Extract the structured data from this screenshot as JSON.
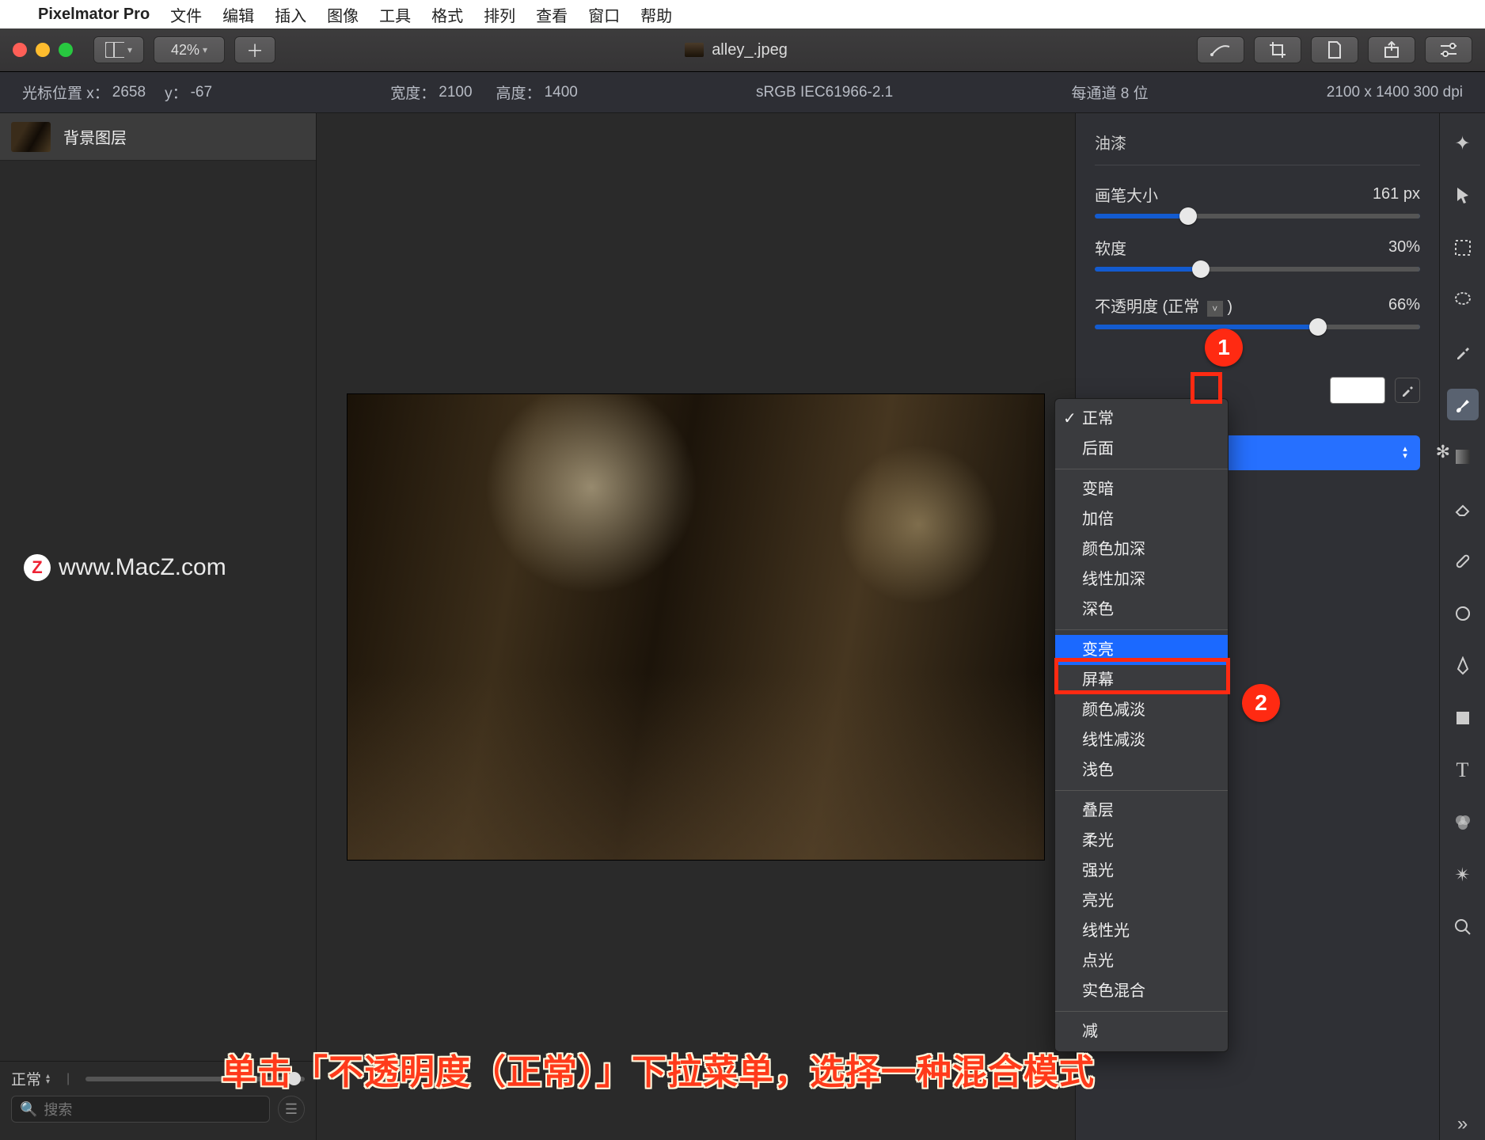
{
  "menubar": {
    "app": "Pixelmator Pro",
    "items": [
      "文件",
      "编辑",
      "插入",
      "图像",
      "工具",
      "格式",
      "排列",
      "查看",
      "窗口",
      "帮助"
    ]
  },
  "toolbar": {
    "zoom": "42%",
    "doc_title": "alley_.jpeg"
  },
  "infobar": {
    "cursor_label": "光标位置 x：",
    "cursor_x": "2658",
    "cursor_y_label": "y：",
    "cursor_y": "-67",
    "width_label": "宽度：",
    "width": "2100",
    "height_label": "高度：",
    "height": "1400",
    "colorspace": "sRGB IEC61966-2.1",
    "depth": "每通道 8 位",
    "dims": "2100 x 1400 300 dpi"
  },
  "layers": {
    "layer0": "背景图层",
    "blend_label": "正常",
    "search_placeholder": "搜索"
  },
  "watermark": "www.MacZ.com",
  "rpanel": {
    "title": "油漆",
    "brush_label": "画笔大小",
    "brush_value": "161 px",
    "soft_label": "软度",
    "soft_value": "30%",
    "opacity_label": "不透明度 (正常",
    "opacity_value": "66%"
  },
  "blend_menu": {
    "g1": [
      "正常",
      "后面"
    ],
    "g2": [
      "变暗",
      "加倍",
      "颜色加深",
      "线性加深",
      "深色"
    ],
    "g3": [
      "变亮",
      "屏幕",
      "颜色减淡",
      "线性减淡",
      "浅色"
    ],
    "g4": [
      "叠层",
      "柔光",
      "强光",
      "亮光",
      "线性光",
      "点光",
      "实色混合"
    ],
    "g5": [
      "减"
    ]
  },
  "badges": {
    "one": "1",
    "two": "2"
  },
  "instruction": "单击「不透明度（正常）」下拉菜单，选择一种混合模式"
}
